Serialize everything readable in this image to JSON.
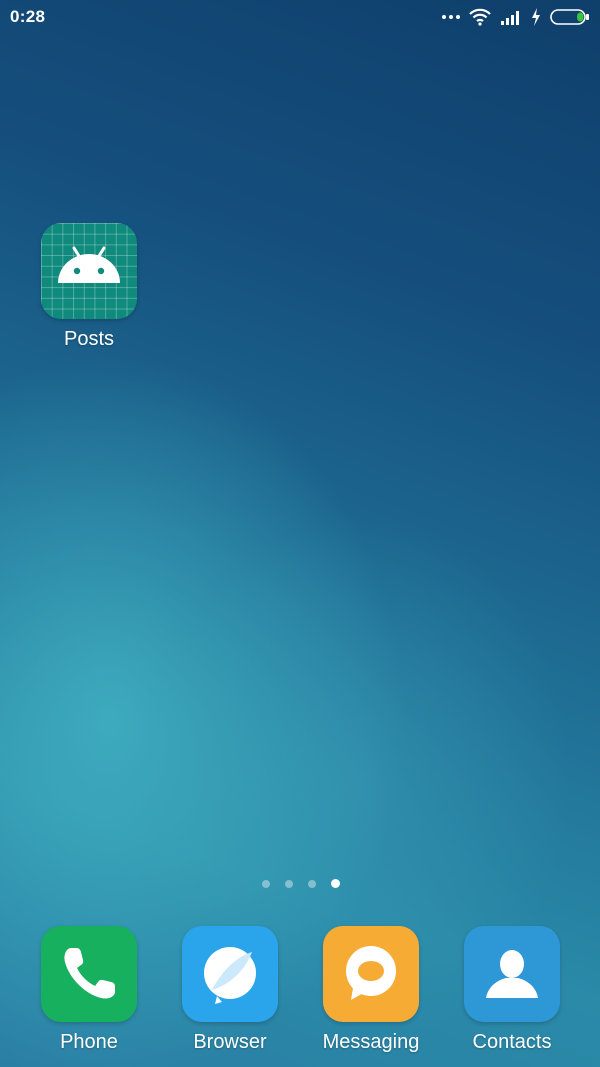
{
  "status_bar": {
    "time": "0:28",
    "icons": [
      "more-dots-icon",
      "wifi-icon",
      "signal-icon",
      "charging-icon",
      "battery-icon"
    ],
    "battery_color": "#3cc43c"
  },
  "desktop": {
    "apps": [
      {
        "label": "Posts",
        "icon": "android-icon",
        "color": "#0f8a7c"
      }
    ]
  },
  "pager": {
    "pages": 4,
    "active": 4
  },
  "dock": {
    "apps": [
      {
        "label": "Phone",
        "icon": "phone-icon",
        "color": "#17b05f"
      },
      {
        "label": "Browser",
        "icon": "browser-icon",
        "color": "#2aa4ea"
      },
      {
        "label": "Messaging",
        "icon": "message-bubble-icon",
        "color": "#f6ac34"
      },
      {
        "label": "Contacts",
        "icon": "contact-person-icon",
        "color": "#2e97d6"
      }
    ]
  }
}
